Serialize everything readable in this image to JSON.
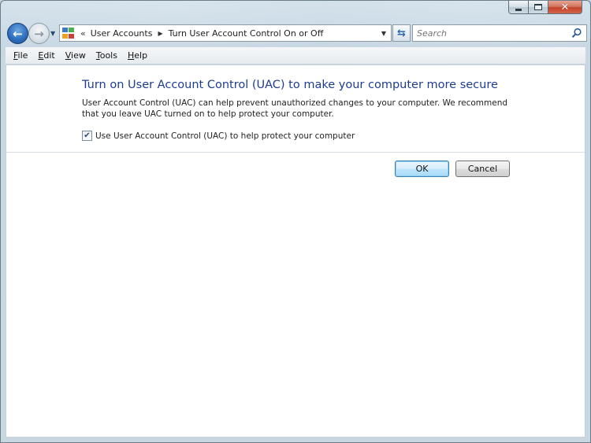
{
  "window": {
    "caption": {
      "minimize": "minimize",
      "maximize": "maximize",
      "close": "close"
    }
  },
  "navigation": {
    "breadcrumb_overflow": "«",
    "breadcrumbs": [
      "User Accounts",
      "Turn User Account Control On or Off"
    ],
    "search_placeholder": "Search"
  },
  "menu": {
    "items": [
      {
        "accel": "F",
        "rest": "ile"
      },
      {
        "accel": "E",
        "rest": "dit"
      },
      {
        "accel": "V",
        "rest": "iew"
      },
      {
        "accel": "T",
        "rest": "ools"
      },
      {
        "accel": "H",
        "rest": "elp"
      }
    ]
  },
  "content": {
    "heading": "Turn on User Account Control (UAC) to make your computer more secure",
    "description": "User Account Control (UAC) can help prevent unauthorized changes to your computer.  We recommend that you leave UAC turned on to help protect your computer.",
    "checkbox_label": "Use User Account Control (UAC) to help protect your computer",
    "checkbox_checked": true
  },
  "buttons": {
    "ok": "OK",
    "cancel": "Cancel"
  },
  "colors": {
    "heading": "#1e3d8f",
    "back_button": "#2f6fc0",
    "close_button": "#c2432a"
  },
  "icons": {
    "back": "back-arrow-icon",
    "forward": "forward-arrow-icon",
    "control_panel": "control-panel-icon",
    "refresh": "refresh-icon",
    "search": "search-icon"
  }
}
